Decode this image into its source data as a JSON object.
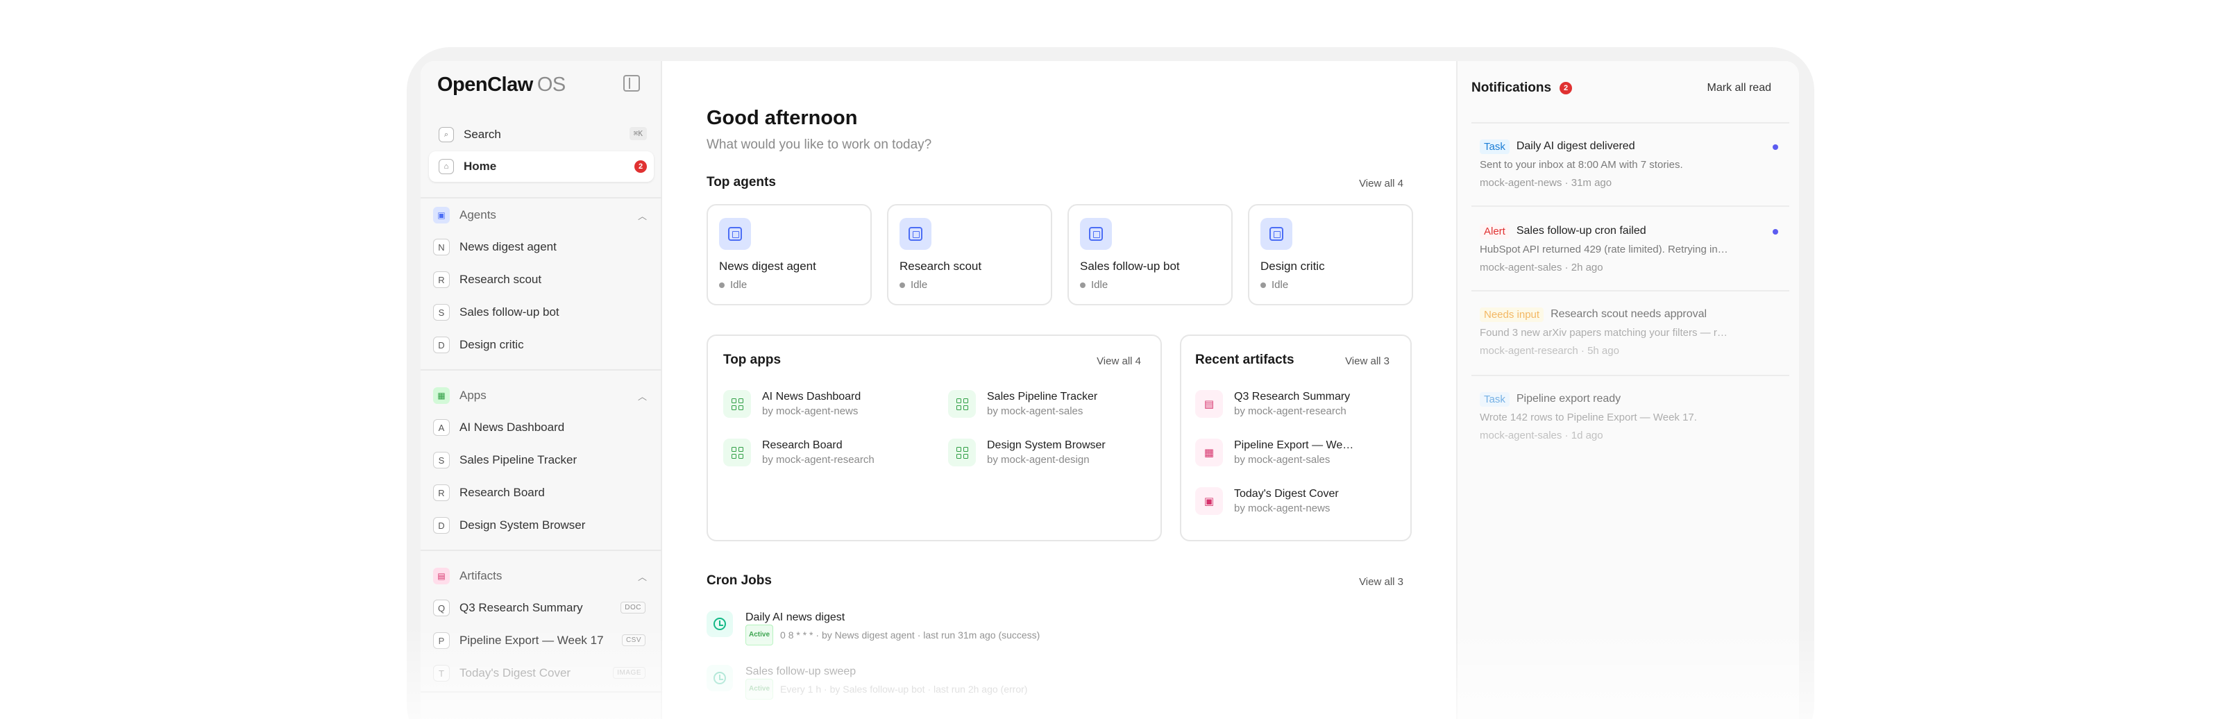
{
  "brand": {
    "name": "OpenClaw",
    "suffix": "OS"
  },
  "nav": {
    "search_label": "Search",
    "search_shortcut": "⌘K",
    "home_label": "Home",
    "home_count": "2"
  },
  "sidebar": {
    "agents": {
      "title": "Agents",
      "items": [
        {
          "letter": "N",
          "label": "News digest agent"
        },
        {
          "letter": "R",
          "label": "Research scout"
        },
        {
          "letter": "S",
          "label": "Sales follow-up bot"
        },
        {
          "letter": "D",
          "label": "Design critic"
        }
      ]
    },
    "apps": {
      "title": "Apps",
      "items": [
        {
          "letter": "A",
          "label": "AI News Dashboard"
        },
        {
          "letter": "S",
          "label": "Sales Pipeline Tracker"
        },
        {
          "letter": "R",
          "label": "Research Board"
        },
        {
          "letter": "D",
          "label": "Design System Browser"
        }
      ]
    },
    "artifacts": {
      "title": "Artifacts",
      "items": [
        {
          "letter": "Q",
          "label": "Q3 Research Summary",
          "tag": "DOC"
        },
        {
          "letter": "P",
          "label": "Pipeline Export — Week 17",
          "tag": "CSV"
        },
        {
          "letter": "T",
          "label": "Today's Digest Cover",
          "tag": "IMAGE"
        }
      ]
    }
  },
  "main": {
    "greeting": "Good afternoon",
    "subtitle": "What would you like to work on today?",
    "top_agents": {
      "title": "Top agents",
      "view_all": "View all 4",
      "cards": [
        {
          "name": "News digest agent",
          "status": "Idle"
        },
        {
          "name": "Research scout",
          "status": "Idle"
        },
        {
          "name": "Sales follow-up bot",
          "status": "Idle"
        },
        {
          "name": "Design critic",
          "status": "Idle"
        }
      ]
    },
    "top_apps": {
      "title": "Top apps",
      "view_all": "View all 4",
      "items": [
        {
          "title": "AI News Dashboard",
          "owner": "by mock-agent-news"
        },
        {
          "title": "Sales Pipeline Tracker",
          "owner": "by mock-agent-sales"
        },
        {
          "title": "Research Board",
          "owner": "by mock-agent-research"
        },
        {
          "title": "Design System Browser",
          "owner": "by mock-agent-design"
        }
      ]
    },
    "recent_artifacts": {
      "title": "Recent artifacts",
      "view_all": "View all 3",
      "items": [
        {
          "title": "Q3 Research Summary",
          "owner": "by mock-agent-research",
          "icon": "document-icon"
        },
        {
          "title": "Pipeline Export — We…",
          "owner": "by mock-agent-sales",
          "icon": "table-icon"
        },
        {
          "title": "Today's Digest Cover",
          "owner": "by mock-agent-news",
          "icon": "image-icon"
        }
      ]
    },
    "cron_jobs": {
      "title": "Cron Jobs",
      "view_all": "View all 3",
      "items": [
        {
          "title": "Daily AI news digest",
          "status": "Active",
          "schedule": "0 8 * * *",
          "agent": "by News digest agent",
          "last_run": "last run 31m ago (success)"
        },
        {
          "title": "Sales follow-up sweep",
          "status": "Active",
          "schedule": "Every 1 h",
          "agent": "by Sales follow-up bot",
          "last_run": "last run 2h ago (error)"
        }
      ]
    }
  },
  "notifications": {
    "title": "Notifications",
    "count": "2",
    "mark_all_read": "Mark all read",
    "items": [
      {
        "badge": "Task",
        "title": "Daily AI digest delivered",
        "body": "Sent to your inbox at 8:00 AM with 7 stories.",
        "source": "mock-agent-news",
        "time": "31m ago"
      },
      {
        "badge": "Alert",
        "title": "Sales follow-up cron failed",
        "body": "HubSpot API returned 429 (rate limited). Retrying in…",
        "source": "mock-agent-sales",
        "time": "2h ago"
      },
      {
        "badge": "Needs input",
        "title": "Research scout needs approval",
        "body": "Found 3 new arXiv papers matching your filters — r…",
        "source": "mock-agent-research",
        "time": "5h ago"
      },
      {
        "badge": "Task",
        "title": "Pipeline export ready",
        "body": "Wrote 142 rows to Pipeline Export — Week 17.",
        "source": "mock-agent-sales",
        "time": "1d ago"
      }
    ]
  },
  "colors": {
    "accent_agent": "#4c6ef5",
    "accent_app": "#2f9e44",
    "accent_artifact": "#d6336c",
    "alert": "#e03131",
    "unread_dot": "#5c5cf0"
  }
}
